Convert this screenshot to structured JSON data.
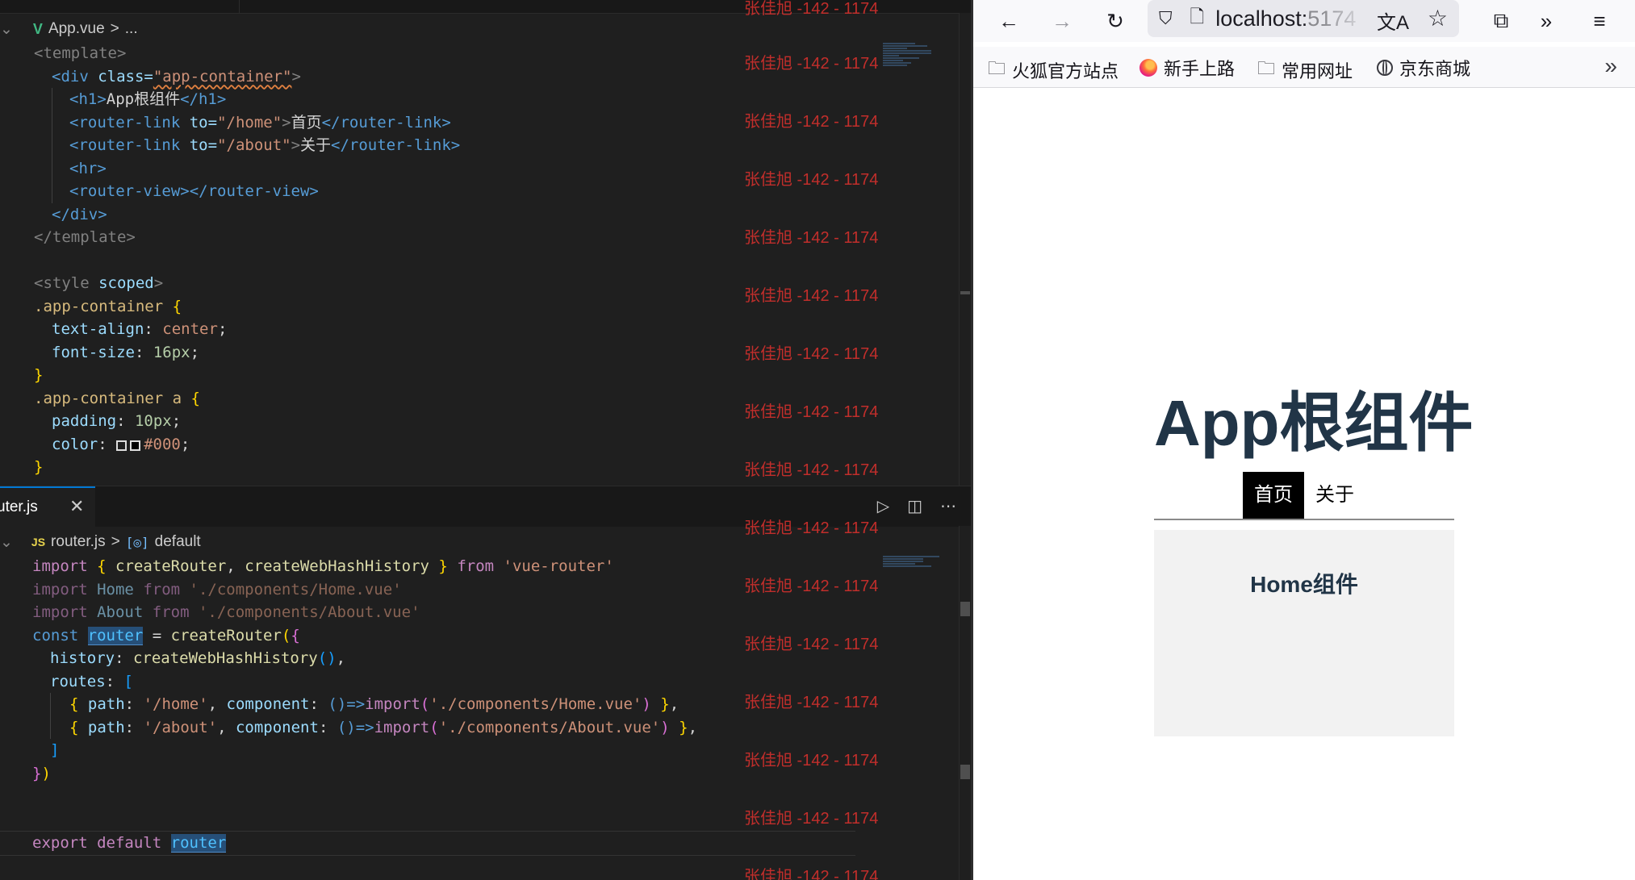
{
  "editor": {
    "top_pane": {
      "breadcrumb_file": "App.vue",
      "breadcrumb_sep": ">",
      "breadcrumb_more": "...",
      "template_open": "<template>",
      "div_open_tag": "<div",
      "class_attr": "class=",
      "class_value": "\"app-container\"",
      "tag_close": ">",
      "h1_open": "<h1>",
      "h1_text": "App根组件",
      "h1_close": "</h1>",
      "rl_open": "<router-link",
      "to_attr": "to=",
      "to_home": "\"/home\"",
      "link_home_text": "首页",
      "rl_close": "</router-link>",
      "to_about": "\"/about\"",
      "link_about_text": "关于",
      "hr_tag": "<hr>",
      "router_view": "<router-view></router-view>",
      "div_close": "</div>",
      "template_close": "</template>",
      "style_open_tag": "<style",
      "style_scoped": "scoped",
      "sel1": ".app-container",
      "brace_open": "{",
      "brace_close": "}",
      "p_text_align": "text-align",
      "v_center": "center",
      "p_font_size": "font-size",
      "v_16px": "16px",
      "sel2": ".app-container a",
      "p_padding": "padding",
      "v_10px": "10px",
      "p_color": "color",
      "v_000": "#000",
      "colon": ":",
      "semicolon": ";"
    },
    "bottom_pane": {
      "tab_name": "uter.js",
      "tab_close": "✕",
      "breadcrumb_file": "router.js",
      "breadcrumb_sep": ">",
      "breadcrumb_symbol": "default",
      "js_icon": "JS",
      "kw_import": "import",
      "kw_from": "from",
      "kw_const": "const",
      "kw_export": "export",
      "kw_default": "default",
      "fn_createRouter": "createRouter",
      "fn_createWebHashHistory": "createWebHashHistory",
      "fn_import": "import",
      "str_vue_router": "'vue-router'",
      "id_home": "Home",
      "id_about": "About",
      "str_home_vue": "'./components/Home.vue'",
      "str_about_vue": "'./components/About.vue'",
      "id_router": "router",
      "op_eq": " = ",
      "p_history": "history",
      "p_routes": "routes",
      "p_path": "path",
      "p_component": "component",
      "str_home_path": "'/home'",
      "str_about_path": "'/about'",
      "arrow": "()=>",
      "punct_comma": ",",
      "punct_colon": ": "
    },
    "watermark_text": "张佳旭 -142 - 1174"
  },
  "browser": {
    "url_host": "localhost:",
    "url_port": "5174",
    "bookmarks": [
      "火狐官方站点",
      "新手上路",
      "常用网址",
      "京东商城"
    ],
    "page": {
      "title": "App根组件",
      "link_home": "首页",
      "link_about": "关于",
      "home_component_title": "Home组件"
    }
  }
}
